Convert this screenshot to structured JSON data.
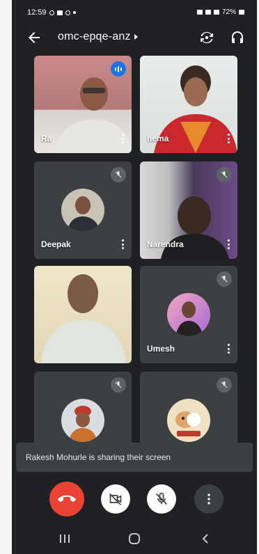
{
  "status_bar": {
    "time": "12:59",
    "right_text": "72%"
  },
  "header": {
    "meeting_code": "omc-epqe-anz"
  },
  "participants": [
    {
      "name": "Ra",
      "state": "speaking"
    },
    {
      "name": "hema",
      "state": "video"
    },
    {
      "name": "Deepak",
      "state": "muted"
    },
    {
      "name": "Narendra",
      "state": "muted"
    },
    {
      "name": "",
      "state": "video"
    },
    {
      "name": "Umesh",
      "state": "muted"
    },
    {
      "name": "",
      "state": "muted"
    },
    {
      "name": "",
      "state": "muted"
    }
  ],
  "toast": {
    "message": "Rakesh Mohurle is sharing their screen"
  },
  "colors": {
    "background": "#202124",
    "tile": "#3c4043",
    "end_call": "#ea4335",
    "speaking": "#1a73e8"
  },
  "icons": {
    "back": "arrow-left-icon",
    "switch_camera": "switch-camera-icon",
    "audio": "headphones-icon",
    "end_call": "phone-hangup-icon",
    "camera": "camera-off-icon",
    "mic": "mic-off-icon",
    "more": "more-vert-icon"
  }
}
